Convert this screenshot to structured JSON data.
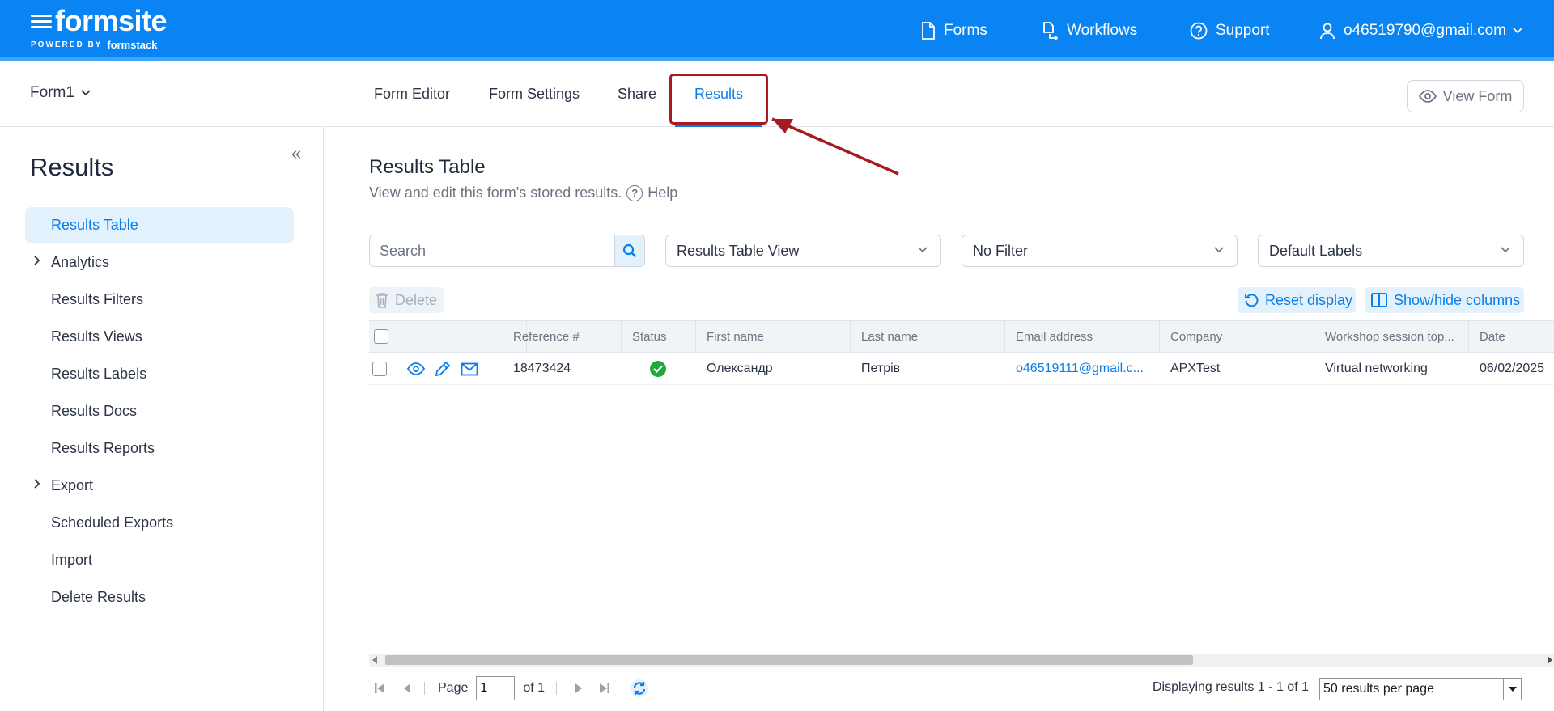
{
  "brand": {
    "name": "formsite",
    "powered_by": "POWERED BY",
    "partner": "formstack"
  },
  "topnav": {
    "forms": "Forms",
    "workflows": "Workflows",
    "support": "Support",
    "user": "o46519790@gmail.com"
  },
  "subheader": {
    "form_name": "Form1",
    "tabs": [
      "Form Editor",
      "Form Settings",
      "Share",
      "Results"
    ],
    "active_tab": "Results",
    "view_form": "View Form"
  },
  "sidebar": {
    "title": "Results",
    "items": [
      {
        "label": "Results Table",
        "active": true
      },
      {
        "label": "Analytics",
        "expandable": true
      },
      {
        "label": "Results Filters"
      },
      {
        "label": "Results Views"
      },
      {
        "label": "Results Labels"
      },
      {
        "label": "Results Docs"
      },
      {
        "label": "Results Reports"
      },
      {
        "label": "Export",
        "expandable": true
      },
      {
        "label": "Scheduled Exports"
      },
      {
        "label": "Import"
      },
      {
        "label": "Delete Results"
      }
    ]
  },
  "main": {
    "title": "Results Table",
    "description": "View and edit this form's stored results.",
    "help": "Help",
    "search_placeholder": "Search",
    "view_select": "Results Table View",
    "filter_select": "No Filter",
    "labels_select": "Default Labels",
    "delete": "Delete",
    "reset_display": "Reset display",
    "show_hide_columns": "Show/hide columns"
  },
  "table": {
    "columns": [
      "Reference #",
      "Status",
      "First name",
      "Last name",
      "Email address",
      "Company",
      "Workshop session top...",
      "Date"
    ],
    "rows": [
      {
        "reference": "18473424",
        "status": "complete",
        "first_name": "Олександр",
        "last_name": "Петрів",
        "email": "o46519111@gmail.c...",
        "company": "APXTest",
        "workshop": "Virtual networking",
        "date": "06/02/2025"
      }
    ]
  },
  "pager": {
    "page_label": "Page",
    "page_value": "1",
    "of_label": "of 1",
    "display_count": "Displaying results 1 - 1 of 1",
    "per_page": "50 results per page"
  },
  "colors": {
    "brand": "#0a84f2",
    "accent": "#0a7ee8",
    "highlight": "#a51c20",
    "success": "#1faa3e"
  }
}
